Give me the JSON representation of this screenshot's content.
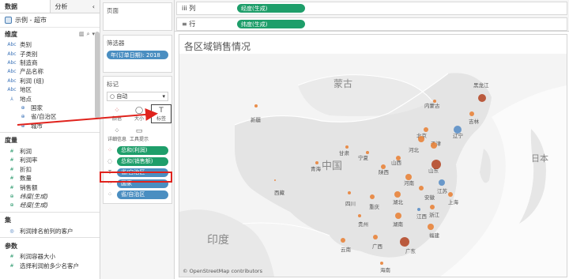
{
  "data_pane": {
    "tabs": [
      {
        "label": "数据"
      },
      {
        "label": "分析"
      }
    ],
    "datasource": "示例 - 超市",
    "dimensions_label": "维度",
    "dimensions": [
      {
        "type": "Abc",
        "name": "类别"
      },
      {
        "type": "Abc",
        "name": "子类别"
      },
      {
        "type": "Abc",
        "name": "制造商"
      },
      {
        "type": "Abc",
        "name": "产品名称"
      },
      {
        "type": "Abc",
        "name": "利润 (组)"
      },
      {
        "type": "Abc",
        "name": "地区"
      },
      {
        "type": "hier",
        "name": "地点"
      },
      {
        "type": "geo",
        "name": "国家"
      },
      {
        "type": "geo",
        "name": "省/自治区"
      },
      {
        "type": "geo",
        "name": "城市"
      }
    ],
    "measures_label": "度量",
    "measures": [
      {
        "type": "#",
        "name": "利润"
      },
      {
        "type": "#",
        "name": "利润率"
      },
      {
        "type": "#",
        "name": "折扣"
      },
      {
        "type": "#",
        "name": "数量"
      },
      {
        "type": "#",
        "name": "销售额"
      },
      {
        "type": "geo",
        "name": "纬度(生成)"
      },
      {
        "type": "geo",
        "name": "经度(生成)"
      }
    ],
    "sets_label": "集",
    "sets": [
      {
        "name": "利润排名前列的客户"
      }
    ],
    "params_label": "参数",
    "params": [
      {
        "name": "利润容器大小"
      },
      {
        "name": "选择利润前多少名客户"
      }
    ]
  },
  "pages_card": {
    "title": "页面"
  },
  "filters_card": {
    "title": "筛选器",
    "filter": "年(订单日期): 2018"
  },
  "marks_card": {
    "title": "标记",
    "mark_type": "自动",
    "buttons": [
      {
        "label": "颜色",
        "icon": "color-dots-icon"
      },
      {
        "label": "大小",
        "icon": "size-circle-icon"
      },
      {
        "label": "标签",
        "icon": "label-t-icon"
      },
      {
        "label": "详细信息",
        "icon": "detail-dots-icon"
      },
      {
        "label": "工具提示",
        "icon": "tooltip-bubble-icon"
      }
    ],
    "fields": [
      {
        "icon": "color-dots-icon",
        "label": "总和(利润)",
        "color": "green"
      },
      {
        "icon": "size-icon",
        "label": "总和(销售额)",
        "color": "green"
      },
      {
        "icon": "label-t-icon",
        "label": "省/自治区",
        "color": "blue"
      },
      {
        "icon": "detail-dots-icon",
        "label": "国家",
        "color": "blue"
      },
      {
        "icon": "detail-dots-icon",
        "label": "省/自治区",
        "color": "blue"
      }
    ]
  },
  "shelves": {
    "columns_label": "列",
    "columns_pill": "经度(生成)",
    "rows_label": "行",
    "rows_pill": "纬度(生成)"
  },
  "viz": {
    "title": "各区域销售情况",
    "attribution": "© OpenStreetMap contributors",
    "map_labels": [
      "蒙古",
      "中国",
      "印度",
      "日本"
    ],
    "province_labels": [
      "黑龙江",
      "吉林",
      "辽宁",
      "内蒙古",
      "新疆",
      "甘肃",
      "宁夏",
      "山西",
      "河北",
      "北京",
      "天津",
      "山东",
      "陕西",
      "河南",
      "青海",
      "西藏",
      "四川",
      "重庆",
      "湖北",
      "安徽",
      "江苏",
      "上海",
      "浙江",
      "湖南",
      "江西",
      "贵州",
      "云南",
      "广西",
      "广东",
      "福建",
      "海南"
    ]
  },
  "colors": {
    "dimension_pill": "#4a8ec1",
    "measure_pill": "#1e9e6a",
    "highlight": "#e0231d",
    "bubble_orange": "#e8833a",
    "bubble_brown": "#b54a2a",
    "bubble_blue": "#5b8fc7"
  }
}
